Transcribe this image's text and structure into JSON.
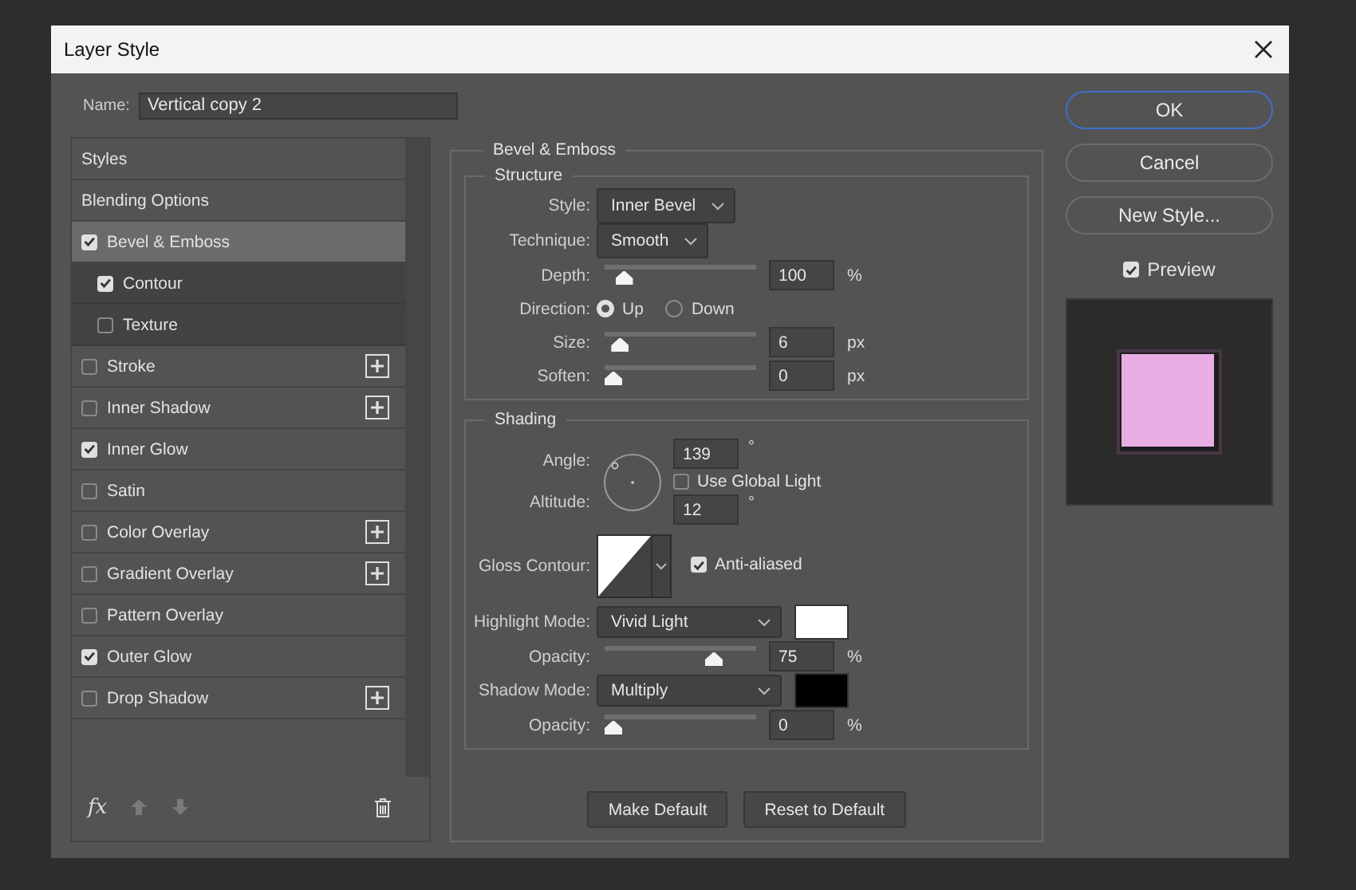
{
  "window": {
    "title": "Layer Style"
  },
  "name_field": {
    "label": "Name:",
    "value": "Vertical copy 2"
  },
  "styles_list": [
    {
      "kind": "header",
      "label": "Styles",
      "selected": false
    },
    {
      "kind": "header",
      "label": "Blending Options",
      "selected": false
    },
    {
      "kind": "effect",
      "label": "Bevel & Emboss",
      "checked": true,
      "selected": true,
      "add": false,
      "children": [
        {
          "label": "Contour",
          "checked": true,
          "selected": false
        },
        {
          "label": "Texture",
          "checked": false,
          "selected": false
        }
      ]
    },
    {
      "kind": "effect",
      "label": "Stroke",
      "checked": false,
      "selected": false,
      "add": true
    },
    {
      "kind": "effect",
      "label": "Inner Shadow",
      "checked": false,
      "selected": false,
      "add": true
    },
    {
      "kind": "effect",
      "label": "Inner Glow",
      "checked": true,
      "selected": false,
      "add": false
    },
    {
      "kind": "effect",
      "label": "Satin",
      "checked": false,
      "selected": false,
      "add": false
    },
    {
      "kind": "effect",
      "label": "Color Overlay",
      "checked": false,
      "selected": false,
      "add": true
    },
    {
      "kind": "effect",
      "label": "Gradient Overlay",
      "checked": false,
      "selected": false,
      "add": true
    },
    {
      "kind": "effect",
      "label": "Pattern Overlay",
      "checked": false,
      "selected": false,
      "add": false
    },
    {
      "kind": "effect",
      "label": "Outer Glow",
      "checked": true,
      "selected": false,
      "add": false
    },
    {
      "kind": "effect",
      "label": "Drop Shadow",
      "checked": false,
      "selected": false,
      "add": true
    }
  ],
  "list_toolbar": {
    "fx": "fx"
  },
  "panel": {
    "title": "Bevel & Emboss",
    "structure": {
      "title": "Structure",
      "rows": [
        {
          "kind": "dropdown",
          "label": "Style:",
          "value": "Inner Bevel"
        },
        {
          "kind": "dropdown",
          "label": "Technique:",
          "value": "Smooth"
        },
        {
          "kind": "slider",
          "label": "Depth:",
          "level": 0.08,
          "value": "100",
          "unit": "%"
        },
        {
          "kind": "radio",
          "label": "Direction:",
          "options": [
            {
              "label": "Up",
              "selected": true
            },
            {
              "label": "Down",
              "selected": false
            }
          ]
        },
        {
          "kind": "slider",
          "label": "Size:",
          "level": 0.05,
          "value": "6",
          "unit": "px"
        },
        {
          "kind": "slider",
          "label": "Soften:",
          "level": 0,
          "value": "0",
          "unit": "px"
        }
      ]
    },
    "shading": {
      "title": "Shading",
      "angle": {
        "label": "Angle:",
        "value": "139",
        "unit": "°"
      },
      "use_global_light": {
        "label": "Use Global Light",
        "checked": false
      },
      "altitude": {
        "label": "Altitude:",
        "value": "12",
        "unit": "°"
      },
      "gloss_contour": {
        "label": "Gloss Contour:"
      },
      "anti_aliased": {
        "label": "Anti-aliased",
        "checked": true
      },
      "rows": [
        {
          "kind": "dropdown",
          "label": "Highlight Mode:",
          "value": "Vivid Light",
          "color": "#ffffff"
        },
        {
          "kind": "slider",
          "label": "Opacity:",
          "level": 0.75,
          "value": "75",
          "unit": "%"
        },
        {
          "kind": "dropdown",
          "label": "Shadow Mode:",
          "value": "Multiply",
          "color": "#000000"
        },
        {
          "kind": "slider",
          "label": "Opacity:",
          "level": 0,
          "value": "0",
          "unit": "%"
        }
      ]
    },
    "buttons": [
      "Make Default",
      "Reset to Default"
    ]
  },
  "actions": [
    {
      "label": "OK",
      "selected": true
    },
    {
      "label": "Cancel",
      "selected": false
    },
    {
      "label": "New Style...",
      "selected": false
    }
  ],
  "preview": {
    "label": "Preview",
    "checked": true
  }
}
